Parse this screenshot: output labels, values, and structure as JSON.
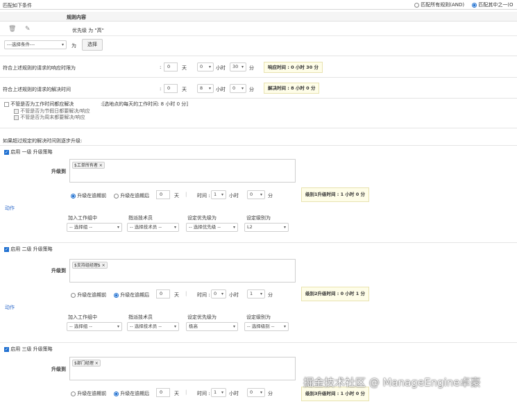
{
  "header": {
    "title": "匹配如下条件",
    "match_all": "匹配所有规则(AND)",
    "match_any": "匹配其中之一(O"
  },
  "rules": {
    "column": "规则内容",
    "row": "优先级 为 \"高\"",
    "condition_select": "---选择条件---",
    "condition_op": "为",
    "select_button": "选择"
  },
  "response": {
    "label": "符合上述规则的请求的响应时限为",
    "colon": ":",
    "days": "0",
    "days_unit": "天",
    "hours": "0",
    "hours_unit": "小时",
    "minutes": "30",
    "minutes_unit": "分",
    "summary": "响应时间 : 0 小时 30 分"
  },
  "resolution": {
    "label": "符合上述规则的请求的解决时间",
    "colon": ":",
    "days": "0",
    "days_unit": "天",
    "hours": "8",
    "hours_unit": "小时",
    "minutes": "0",
    "minutes_unit": "分",
    "summary": "解决时间 : 8 小时 0 分"
  },
  "options": {
    "ignore_hours": "不管是否为工作时间都应解决",
    "work_hours_note": ":[选地点的每天的工作时间: 8 小时 0 分]",
    "ignore_holidays": "不管是否为节假日都要解决/响应",
    "ignore_weekends": "不管是否为周末都要解决/响应"
  },
  "escalation_intro": "如果超过规定的解决时间则逐步升级:",
  "action_link": "动作",
  "levels": [
    {
      "enable": "启用 一级 升级策略",
      "escalate_to": "升级到",
      "recipient": "$工单所有者",
      "before": "升级在逾期前",
      "after": "升级在逾期后",
      "selected": "before",
      "days": "0",
      "days_unit": "天",
      "time_label": "时间 :",
      "hours": "1",
      "hours_unit": "小时",
      "minutes": "0",
      "minutes_unit": "分",
      "summary": "级别1升级时间 : 1 小时 0 分",
      "add_group": "加入工作组中",
      "assign_tech": "指派技术员",
      "set_priority": "设定优先级为",
      "set_level": "设定级别为",
      "group_value": "-- 选择组 --",
      "tech_value": "-- 选择技术员 --",
      "priority_value": "-- 选择优先级 --",
      "level_value": "L2"
    },
    {
      "enable": "启用 二级 升级策略",
      "escalate_to": "升级到",
      "recipient": "$支持组经理$",
      "before": "升级在逾期前",
      "after": "升级在逾期后",
      "selected": "after",
      "days": "0",
      "days_unit": "天",
      "time_label": "时间 :",
      "hours": "0",
      "hours_unit": "小时",
      "minutes": "1",
      "minutes_unit": "分",
      "summary": "级别2升级时间 : 0 小时 1 分",
      "add_group": "加入工作组中",
      "assign_tech": "指派技术员",
      "set_priority": "设定优先级为",
      "set_level": "设定级别为",
      "group_value": "-- 选择组 --",
      "tech_value": "-- 选择技术员 --",
      "priority_value": "极高",
      "level_value": "-- 选择级别 --"
    },
    {
      "enable": "启用 三级 升级策略",
      "escalate_to": "升级到",
      "recipient": "$部门经理",
      "before": "升级在逾期前",
      "after": "升级在逾期后",
      "selected": "after",
      "days": "0",
      "days_unit": "天",
      "time_label": "时间 :",
      "hours": "1",
      "hours_unit": "小时",
      "minutes": "0",
      "minutes_unit": "分",
      "summary": "级别3升级时间 : 1 小时 0 分"
    }
  ],
  "watermark": "掘金技术社区 @ ManageEngine卓豪"
}
